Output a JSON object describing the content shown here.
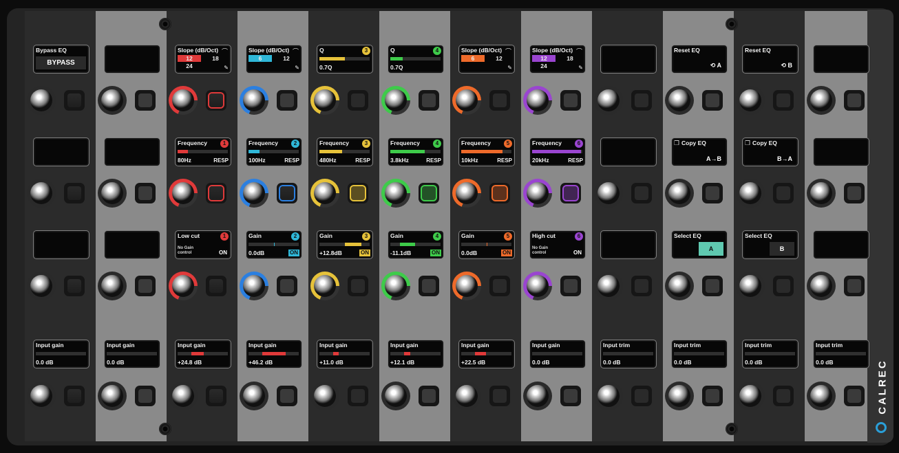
{
  "brand": "CALREC",
  "colors": {
    "red": "#e03a3a",
    "cyan": "#2fb7d8",
    "yellow": "#e6c23a",
    "green": "#3ecb4a",
    "orange": "#ee6a2a",
    "purple": "#9a45d0",
    "teal": "#5fc9b0",
    "blue": "#2b7fe0"
  },
  "rows": [
    {
      "displays": [
        {
          "type": "bypass",
          "title": "Bypass EQ",
          "label": "BYPASS"
        },
        {
          "type": "empty"
        },
        {
          "type": "slope",
          "title": "Slope (dB/Oct)",
          "icon": "lowpass-curve-icon",
          "values": [
            "12",
            "18",
            "24"
          ],
          "selected": 0,
          "color": "red"
        },
        {
          "type": "slope",
          "title": "Slope (dB/Oct)",
          "icon": "highshelf-icon",
          "values": [
            "6",
            "12"
          ],
          "selected": 0,
          "color": "cyan"
        },
        {
          "type": "q",
          "title": "Q",
          "icon": "bell-icon",
          "badge": "3",
          "value": "0.7Q",
          "fill": 0.5,
          "color": "yellow"
        },
        {
          "type": "q",
          "title": "Q",
          "icon": "bell-icon",
          "badge": "4",
          "value": "0.7Q",
          "fill": 0.25,
          "color": "green"
        },
        {
          "type": "slope",
          "title": "Slope (dB/Oct)",
          "icon": "lowshelf-icon",
          "values": [
            "6",
            "12"
          ],
          "selected": 0,
          "color": "orange"
        },
        {
          "type": "slope",
          "title": "Slope (dB/Oct)",
          "icon": "highpass-curve-icon",
          "values": [
            "12",
            "18",
            "24"
          ],
          "selected": 0,
          "color": "purple"
        },
        {
          "type": "empty"
        },
        {
          "type": "action",
          "title": "Reset EQ",
          "label": "A",
          "icon": "reset-icon"
        },
        {
          "type": "action",
          "title": "Reset EQ",
          "label": "B",
          "icon": "reset-icon"
        },
        {
          "type": "empty"
        }
      ],
      "knobRings": [
        "",
        "",
        "red",
        "blue",
        "yellow",
        "green",
        "orange",
        "purple",
        "",
        "",
        "",
        ""
      ],
      "buttonRings": [
        "",
        "",
        "red",
        "",
        "",
        "",
        "",
        "",
        "",
        "",
        "",
        ""
      ]
    },
    {
      "displays": [
        {
          "type": "empty"
        },
        {
          "type": "empty"
        },
        {
          "type": "freq",
          "title": "Frequency",
          "badge": "1",
          "value": "80Hz",
          "fill": 0.2,
          "color": "red",
          "resp": "RESP"
        },
        {
          "type": "freq",
          "title": "Frequency",
          "badge": "2",
          "value": "100Hz",
          "fill": 0.22,
          "color": "cyan",
          "resp": "RESP"
        },
        {
          "type": "freq",
          "title": "Frequency",
          "badge": "3",
          "value": "480Hz",
          "fill": 0.45,
          "color": "yellow",
          "resp": "RESP"
        },
        {
          "type": "freq",
          "title": "Frequency",
          "badge": "4",
          "value": "3.8kHz",
          "fill": 0.68,
          "color": "green",
          "resp": "RESP"
        },
        {
          "type": "freq",
          "title": "Frequency",
          "badge": "5",
          "value": "10kHz",
          "fill": 0.82,
          "color": "orange",
          "resp": "RESP"
        },
        {
          "type": "freq",
          "title": "Frequency",
          "badge": "6",
          "value": "20kHz",
          "fill": 0.97,
          "color": "purple",
          "resp": "RESP"
        },
        {
          "type": "empty"
        },
        {
          "type": "copy",
          "title": "Copy EQ",
          "label": "A→B"
        },
        {
          "type": "copy",
          "title": "Copy EQ",
          "label": "B→A"
        },
        {
          "type": "empty"
        }
      ],
      "knobRings": [
        "",
        "",
        "red",
        "blue",
        "yellow",
        "green",
        "orange",
        "purple",
        "",
        "",
        "",
        ""
      ],
      "buttonRings": [
        "",
        "",
        "red",
        "blue",
        "yellow",
        "green",
        "orange",
        "purple",
        "",
        "",
        "",
        ""
      ]
    },
    {
      "displays": [
        {
          "type": "empty"
        },
        {
          "type": "empty"
        },
        {
          "type": "cut",
          "title": "Low cut",
          "badge": "1",
          "sub": "No Gain control",
          "on": "ON",
          "color": "red"
        },
        {
          "type": "gain",
          "title": "Gain",
          "badge": "2",
          "value": "0.0dB",
          "on": "ON",
          "color": "cyan",
          "fill": 0
        },
        {
          "type": "gain",
          "title": "Gain",
          "badge": "3",
          "value": "+12.8dB",
          "on": "ON",
          "color": "yellow",
          "fill": 0.34
        },
        {
          "type": "gain",
          "title": "Gain",
          "badge": "4",
          "value": "-11.1dB",
          "on": "ON",
          "color": "green",
          "fill": -0.31
        },
        {
          "type": "gain",
          "title": "Gain",
          "badge": "5",
          "value": "0.0dB",
          "on": "ON",
          "color": "orange",
          "fill": 0
        },
        {
          "type": "cut",
          "title": "High cut",
          "badge": "6",
          "sub": "No Gain control",
          "on": "ON",
          "color": "purple"
        },
        {
          "type": "empty"
        },
        {
          "type": "select",
          "title": "Select EQ",
          "label": "A",
          "active": true
        },
        {
          "type": "select",
          "title": "Select EQ",
          "label": "B",
          "active": false
        },
        {
          "type": "empty"
        }
      ],
      "knobRings": [
        "",
        "",
        "red",
        "blue",
        "yellow",
        "green",
        "orange",
        "purple",
        "",
        "",
        "",
        ""
      ],
      "buttonRings": [
        "",
        "",
        "",
        "",
        "",
        "",
        "",
        "",
        "",
        "",
        "",
        ""
      ]
    },
    {
      "displays": [
        {
          "type": "level",
          "title": "Input gain",
          "value": "0.0 dB",
          "fill": 0
        },
        {
          "type": "level",
          "title": "Input gain",
          "value": "0.0 dB",
          "fill": 0
        },
        {
          "type": "level",
          "title": "Input gain",
          "value": "+24.8 dB",
          "fill": 0.25
        },
        {
          "type": "level",
          "title": "Input gain",
          "value": "+46.2 dB",
          "fill": 0.46
        },
        {
          "type": "level",
          "title": "Input gain",
          "value": "+11.0 dB",
          "fill": 0.11
        },
        {
          "type": "level",
          "title": "Input gain",
          "value": "+12.1 dB",
          "fill": 0.12
        },
        {
          "type": "level",
          "title": "Input gain",
          "value": "+22.5 dB",
          "fill": 0.22
        },
        {
          "type": "level",
          "title": "Input gain",
          "value": "0.0 dB",
          "fill": 0
        },
        {
          "type": "level",
          "title": "Input trim",
          "value": "0.0 dB",
          "fill": 0
        },
        {
          "type": "level",
          "title": "Input trim",
          "value": "0.0 dB",
          "fill": 0
        },
        {
          "type": "level",
          "title": "Input trim",
          "value": "0.0 dB",
          "fill": 0
        },
        {
          "type": "level",
          "title": "Input trim",
          "value": "0.0 dB",
          "fill": 0
        }
      ],
      "knobRings": [
        "",
        "",
        "",
        "",
        "",
        "",
        "",
        "",
        "",
        "",
        "",
        ""
      ],
      "buttonRings": [
        "",
        "",
        "",
        "",
        "",
        "",
        "",
        "",
        "",
        "",
        "",
        ""
      ]
    }
  ]
}
